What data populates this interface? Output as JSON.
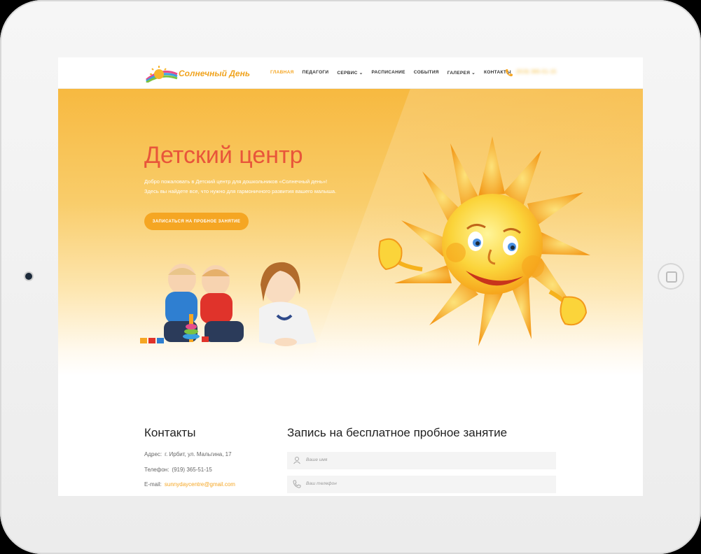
{
  "header": {
    "logo_text": "Солнечный День",
    "nav": [
      {
        "label": "ГЛАВНАЯ",
        "active": true
      },
      {
        "label": "ПЕДАГОГИ",
        "active": false
      },
      {
        "label": "СЕРВИС ⌄",
        "active": false
      },
      {
        "label": "РАСПИСАНИЕ",
        "active": false
      },
      {
        "label": "СОБЫТИЯ",
        "active": false
      },
      {
        "label": "ГАЛЕРЕЯ ⌄",
        "active": false
      },
      {
        "label": "КОНТАКТЫ",
        "active": false
      }
    ],
    "phone_icon": "phone-icon",
    "phone": "(919) 365-51-15"
  },
  "hero": {
    "title": "Детский центр",
    "subtitle_line1": "Добро пожаловать в Детский центр для дошкольников «Солнечный день»!",
    "subtitle_line2": "Здесь вы найдете все, что нужно для гармоничного развития вашего малыша.",
    "cta_label": "ЗАПИСАТЬСЯ НА ПРОБНОЕ ЗАНЯТИЕ"
  },
  "contacts": {
    "title": "Контакты",
    "address_label": "Адрес:",
    "address": "г. Ирбит, ул. Мальгина, 17",
    "phone_label": "Телефон:",
    "phone": "(919) 365-51-15",
    "email_label": "E-mail:",
    "email": "sunnydaycentre@gmail.com"
  },
  "signup": {
    "title": "Запись на бесплатное пробное занятие",
    "name_placeholder": "Ваше имя",
    "phone_placeholder": "Ваш телефон"
  },
  "colors": {
    "accent": "#f5a623",
    "title_red": "#e8553a"
  }
}
